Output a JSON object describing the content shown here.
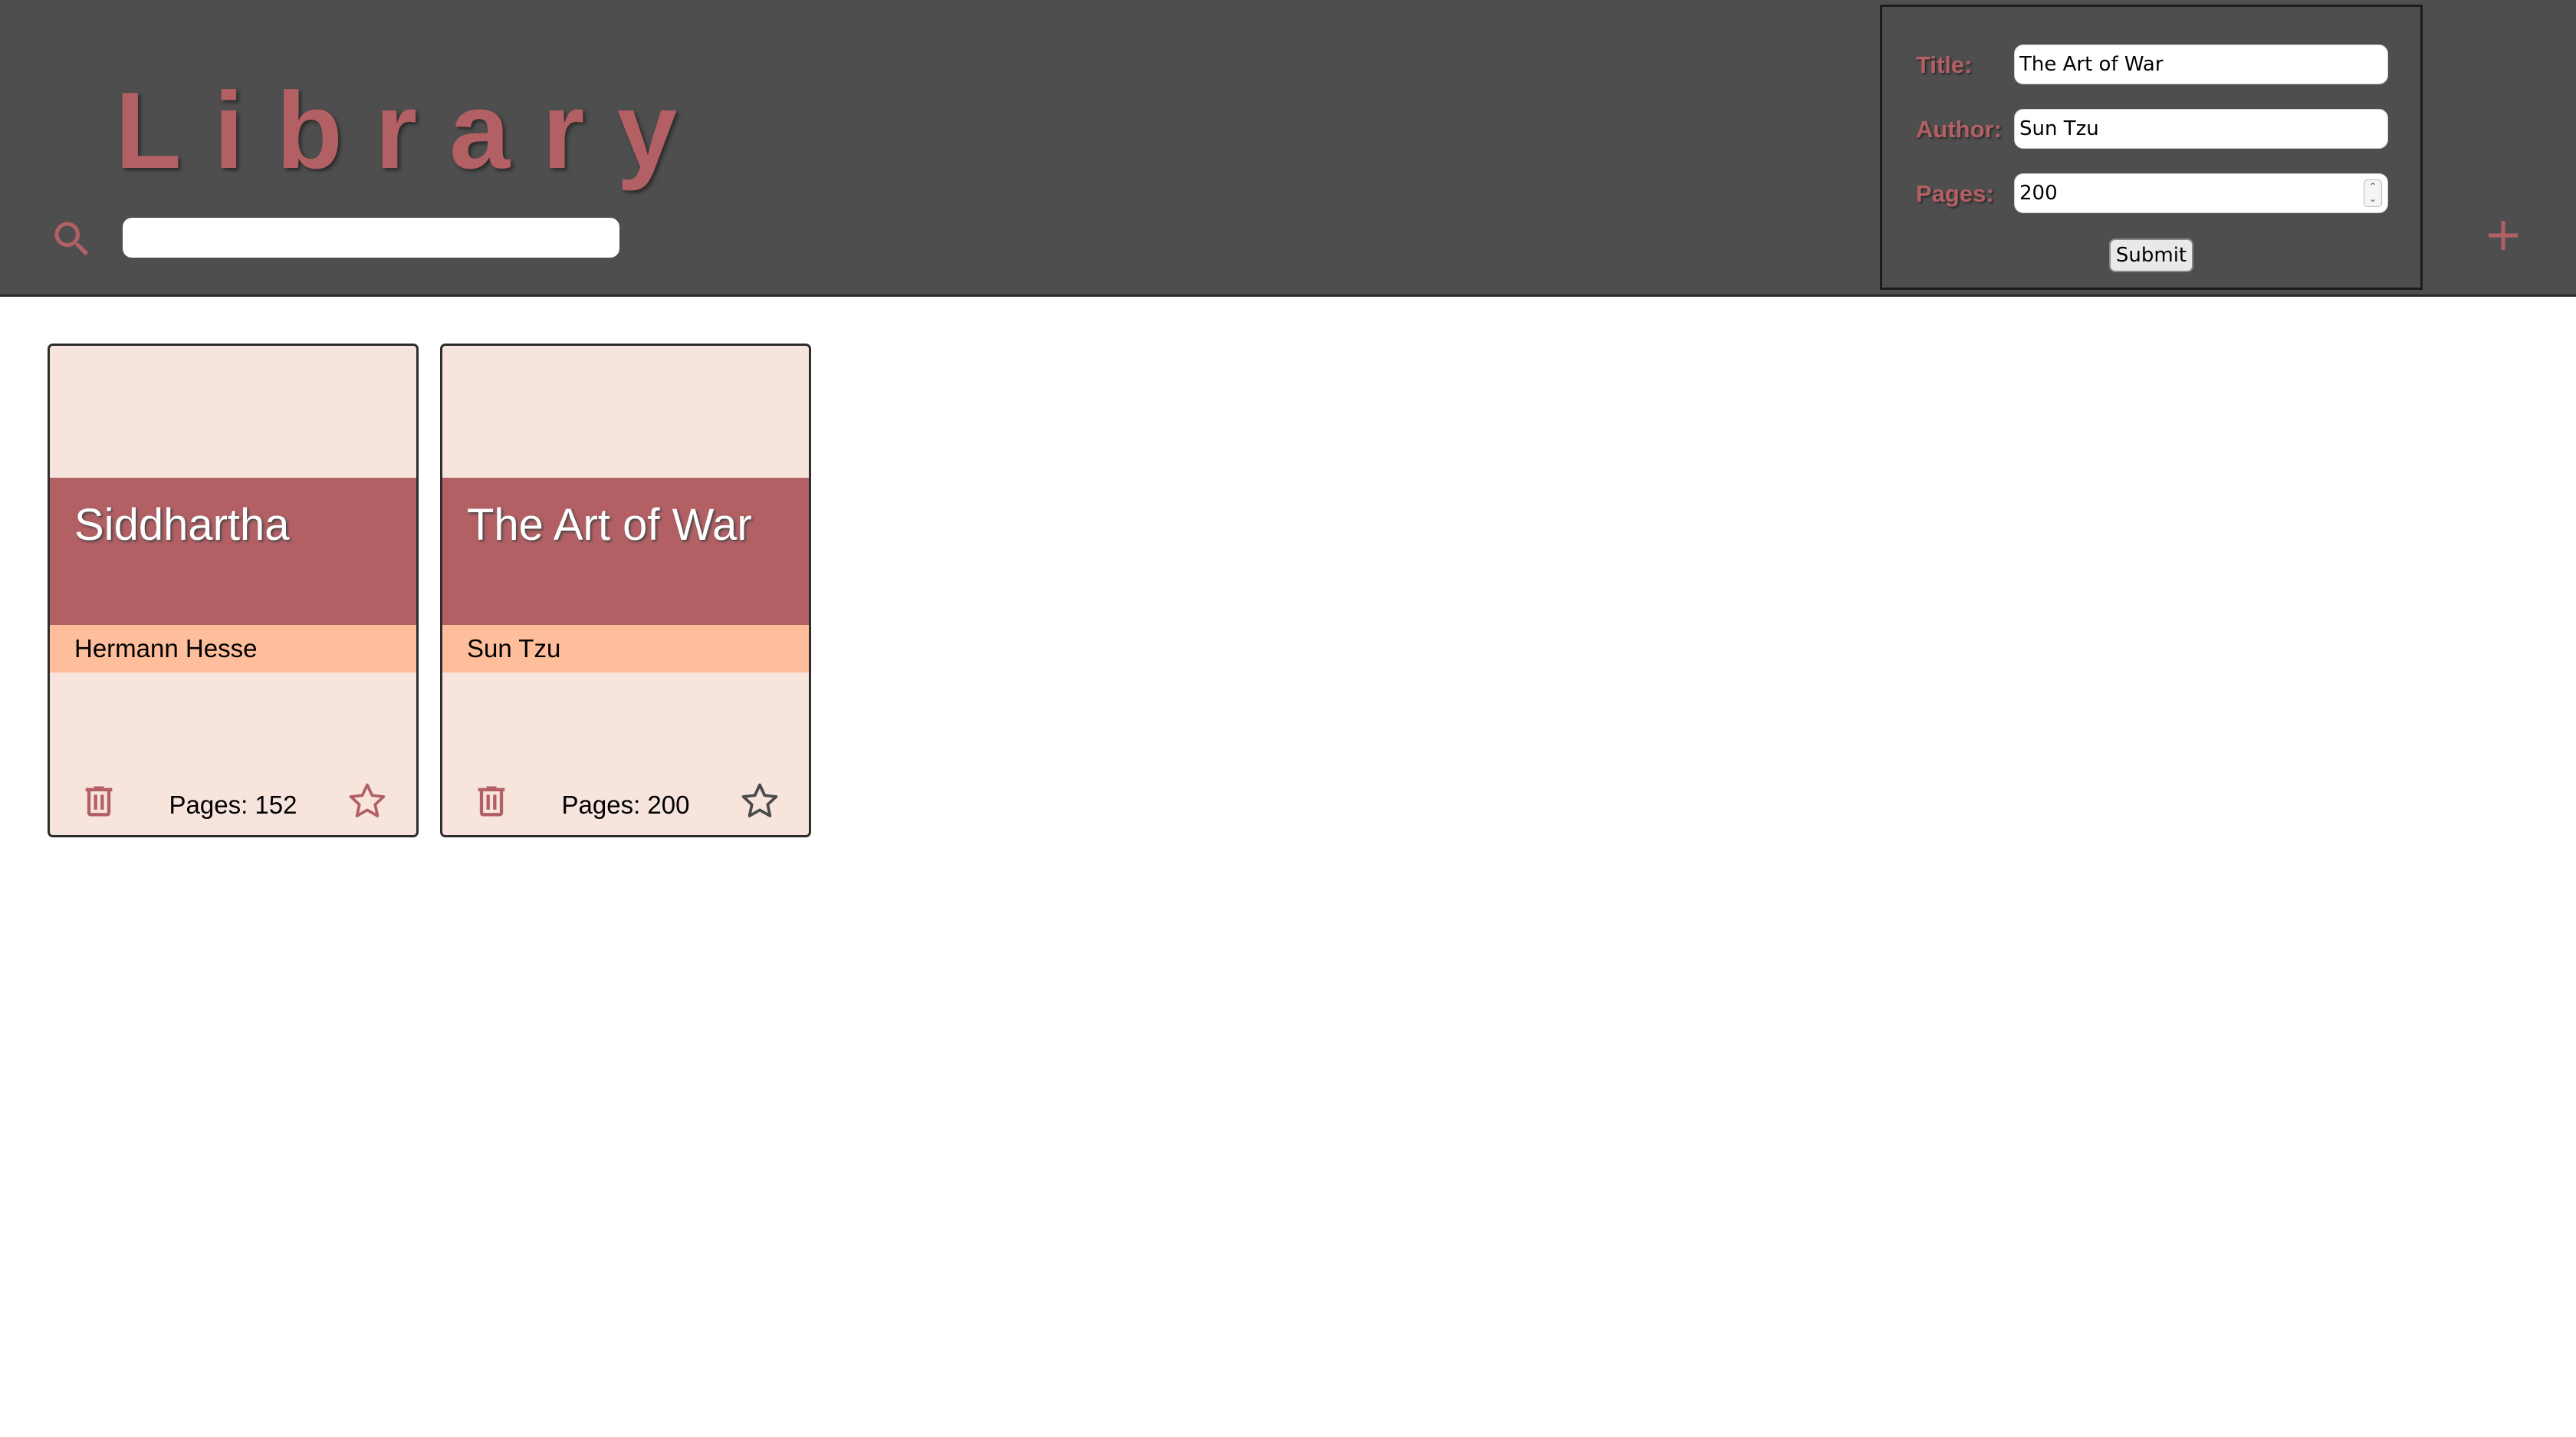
{
  "app": {
    "title": "Library"
  },
  "search": {
    "value": "",
    "icon": "search-icon"
  },
  "form": {
    "title_label": "Title:",
    "title_value": "The Art of War",
    "author_label": "Author:",
    "author_value": "Sun Tzu",
    "pages_label": "Pages:",
    "pages_value": "200",
    "submit_label": "Submit"
  },
  "add_button": {
    "icon": "plus-icon"
  },
  "books": [
    {
      "title": "Siddhartha",
      "author": "Hermann Hesse",
      "pages": "Pages: 152",
      "favorite": false
    },
    {
      "title": "The Art of War",
      "author": "Sun Tzu",
      "pages": "Pages: 200",
      "favorite": false
    }
  ],
  "colors": {
    "header_bg": "#4e4e4e",
    "accent": "#b26064",
    "card_bg": "#f7e4dd",
    "author_band": "#ffbe9b"
  }
}
